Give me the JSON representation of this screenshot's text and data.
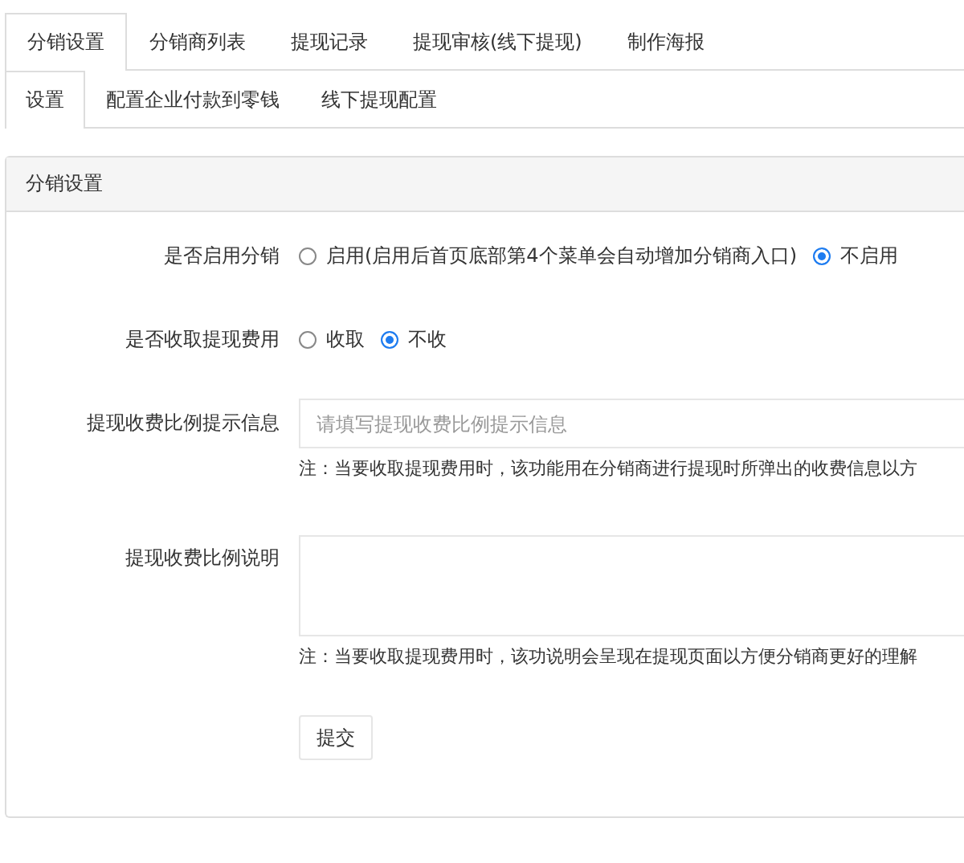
{
  "tabs": [
    {
      "label": "分销设置",
      "selected": true
    },
    {
      "label": "分销商列表",
      "selected": false
    },
    {
      "label": "提现记录",
      "selected": false
    },
    {
      "label": "提现审核(线下提现)",
      "selected": false
    },
    {
      "label": "制作海报",
      "selected": false
    }
  ],
  "sub_tabs": [
    {
      "label": "设置",
      "selected": true
    },
    {
      "label": "配置企业付款到零钱",
      "selected": false
    },
    {
      "label": "线下提现配置",
      "selected": false
    }
  ],
  "panel": {
    "title": "分销设置",
    "fields": [
      {
        "kind": "radio",
        "label": "是否启用分销",
        "options": [
          {
            "label": "启用(启用后首页底部第4个菜单会自动增加分销商入口)",
            "selected": false
          },
          {
            "label": "不启用",
            "selected": true
          }
        ]
      },
      {
        "kind": "radio",
        "label": "是否收取提现费用",
        "options": [
          {
            "label": "收取",
            "selected": false
          },
          {
            "label": "不收",
            "selected": true
          }
        ]
      },
      {
        "kind": "input",
        "label": "提现收费比例提示信息",
        "placeholder": "请填写提现收费比例提示信息",
        "note": "注：当要收取提现费用时，该功能用在分销商进行提现时所弹出的收费信息以方"
      },
      {
        "kind": "textarea",
        "label": "提现收费比例说明",
        "note": "注：当要收取提现费用时，该功说明会呈现在提现页面以方便分销商更好的理解"
      }
    ],
    "submit": "提交"
  }
}
